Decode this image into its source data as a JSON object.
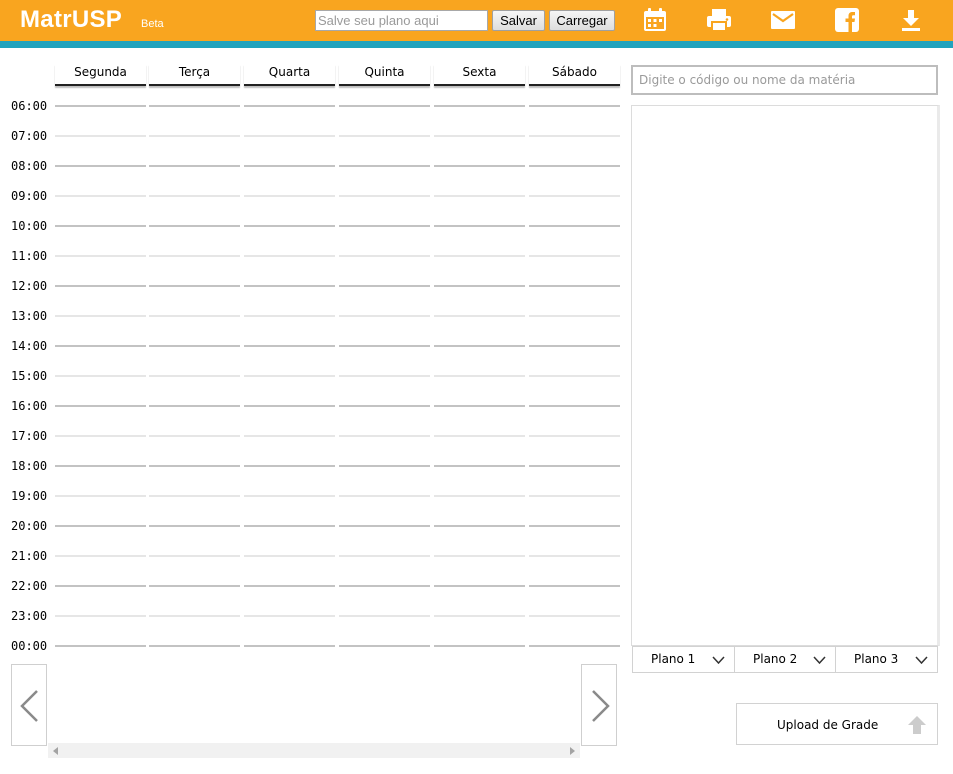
{
  "app": {
    "logo": "MatrUSP",
    "logo_badge": "Beta",
    "brand_color": "#f9a51f",
    "stripe_color": "#22a3bd"
  },
  "toolbar": {
    "plan_input_placeholder": "Salve seu plano aqui",
    "plan_input_value": "",
    "save_label": "Salvar",
    "load_label": "Carregar",
    "icons": [
      "calendar-icon",
      "print-icon",
      "email-icon",
      "facebook-icon",
      "download-icon"
    ]
  },
  "schedule": {
    "days": [
      "Segunda",
      "Terça",
      "Quarta",
      "Quinta",
      "Sexta",
      "Sábado"
    ],
    "hours": [
      "06:00",
      "07:00",
      "08:00",
      "09:00",
      "10:00",
      "11:00",
      "12:00",
      "13:00",
      "14:00",
      "15:00",
      "16:00",
      "17:00",
      "18:00",
      "19:00",
      "20:00",
      "21:00",
      "22:00",
      "23:00",
      "00:00"
    ],
    "prev_icon": "chevron-left-icon",
    "next_icon": "chevron-right-icon"
  },
  "search": {
    "placeholder": "Digite o código ou nome da matéria",
    "value": ""
  },
  "plans": {
    "tabs": [
      "Plano 1",
      "Plano 2",
      "Plano 3"
    ],
    "dropdown_icon": "chevron-down-icon"
  },
  "upload": {
    "label": "Upload de Grade",
    "icon": "arrow-up-icon"
  }
}
